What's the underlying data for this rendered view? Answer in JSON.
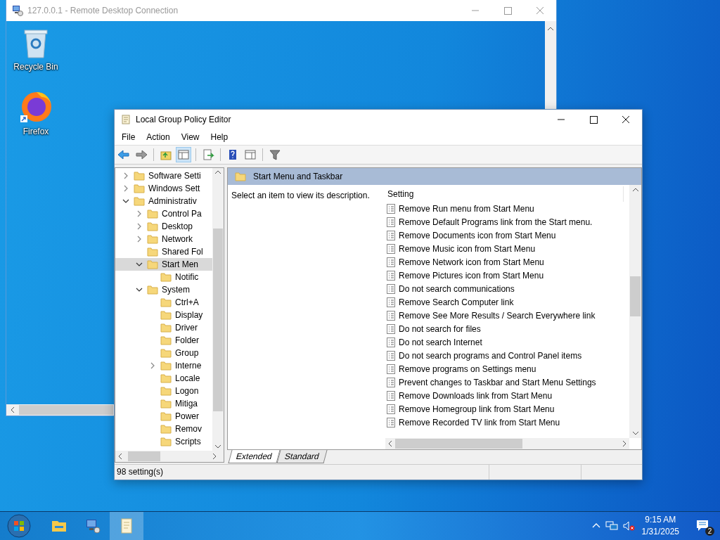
{
  "remote_desktop": {
    "title": "127.0.0.1 - Remote Desktop Connection"
  },
  "desktop_icons": [
    {
      "label": "Recycle Bin",
      "kind": "recycle"
    },
    {
      "label": "Firefox",
      "kind": "browser"
    }
  ],
  "editor": {
    "title": "Local Group Policy Editor",
    "menu": [
      "File",
      "Action",
      "View",
      "Help"
    ],
    "toolbar": [
      {
        "kind": "back",
        "pressed": false
      },
      {
        "kind": "forward",
        "pressed": false
      },
      {
        "kind": "up",
        "pressed": false
      },
      {
        "kind": "tree",
        "pressed": true
      },
      {
        "kind": "export",
        "pressed": false
      },
      {
        "kind": "help",
        "pressed": false
      },
      {
        "kind": "pane",
        "pressed": false
      },
      {
        "kind": "filter",
        "pressed": false
      }
    ],
    "tree": [
      {
        "label": "Software Setti",
        "expanded": false,
        "selected": false
      },
      {
        "label": "Windows Sett",
        "expanded": false,
        "selected": false
      },
      {
        "label": "Administrativ",
        "expanded": true,
        "selected": false,
        "children": [
          {
            "label": "Control Pa",
            "expanded": false,
            "selected": false
          },
          {
            "label": "Desktop",
            "expanded": false,
            "selected": false
          },
          {
            "label": "Network",
            "expanded": false,
            "selected": false
          },
          {
            "label": "Shared Fol",
            "selected": false
          },
          {
            "label": "Start Men",
            "expanded": true,
            "selected": true,
            "children": [
              {
                "label": "Notific",
                "selected": false
              }
            ]
          },
          {
            "label": "System",
            "expanded": true,
            "selected": false,
            "children": [
              {
                "label": "Ctrl+A",
                "selected": false
              },
              {
                "label": "Display",
                "selected": false
              },
              {
                "label": "Driver",
                "selected": false
              },
              {
                "label": "Folder",
                "selected": false
              },
              {
                "label": "Group",
                "selected": false
              },
              {
                "label": "Interne",
                "expanded": false,
                "selected": false
              },
              {
                "label": "Locale",
                "selected": false
              },
              {
                "label": "Logon",
                "selected": false
              },
              {
                "label": "Mitiga",
                "selected": false
              },
              {
                "label": "Power",
                "selected": false
              },
              {
                "label": "Remov",
                "selected": false
              },
              {
                "label": "Scripts",
                "selected": false
              }
            ]
          }
        ]
      }
    ],
    "header": "Start Menu and Taskbar",
    "description": "Select an item to view its description.",
    "column": "Setting",
    "settings": [
      "Remove Run menu from Start Menu",
      "Remove Default Programs link from the Start menu.",
      "Remove Documents icon from Start Menu",
      "Remove Music icon from Start Menu",
      "Remove Network icon from Start Menu",
      "Remove Pictures icon from Start Menu",
      "Do not search communications",
      "Remove Search Computer link",
      "Remove See More Results / Search Everywhere link",
      "Do not search for files",
      "Do not search Internet",
      "Do not search programs and Control Panel items",
      "Remove programs on Settings menu",
      "Prevent changes to Taskbar and Start Menu Settings",
      "Remove Downloads link from Start Menu",
      "Remove Homegroup link from Start Menu",
      "Remove Recorded TV link from Start Menu"
    ],
    "tabs": [
      {
        "label": "Extended",
        "selected": true
      },
      {
        "label": "Standard",
        "selected": false
      }
    ],
    "status_bar": "98 setting(s)"
  },
  "taskbar": {
    "apps": [
      {
        "kind": "explorer",
        "active": false
      },
      {
        "kind": "remote",
        "active": false
      },
      {
        "kind": "policy",
        "active": true
      }
    ],
    "time": "9:15 AM",
    "date": "1/31/2025",
    "volume_muted": true,
    "notifications": "2"
  }
}
